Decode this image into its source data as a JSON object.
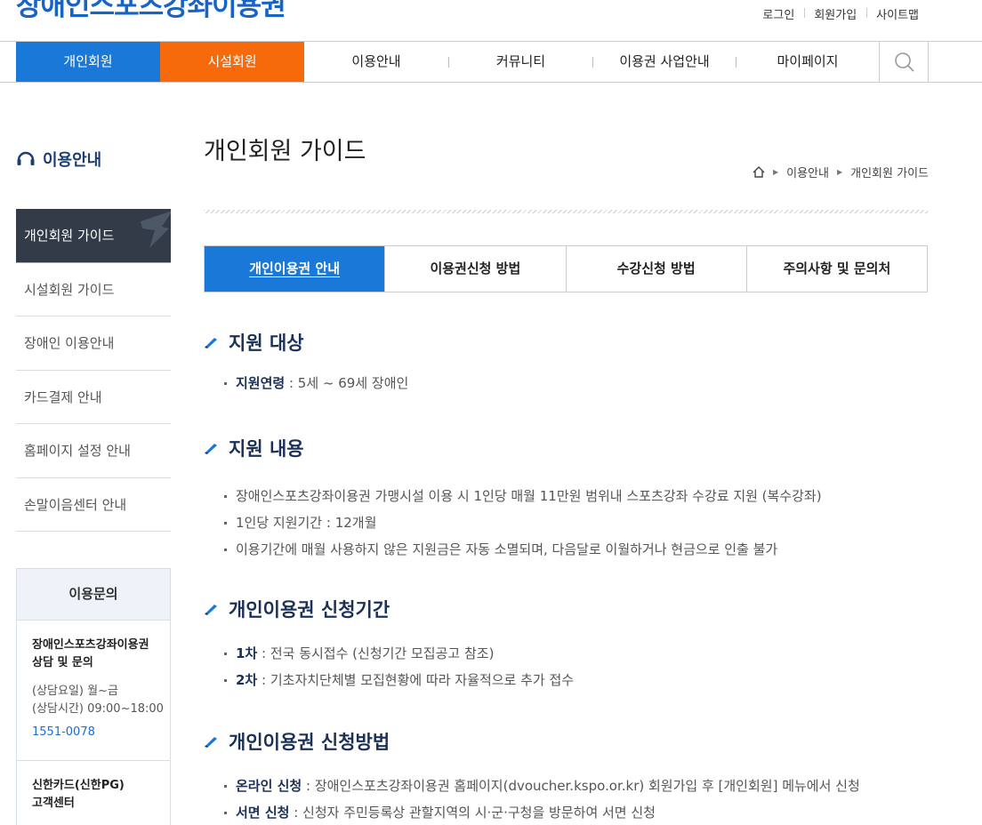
{
  "site": {
    "title": "장애인스포츠강좌이용권"
  },
  "util_links": [
    "로그인",
    "회원가입",
    "사이트맵"
  ],
  "gnb": {
    "items": [
      "개인회원",
      "시설회원",
      "이용안내",
      "커뮤니티",
      "이용권 사업안내",
      "마이페이지"
    ],
    "search_icon": "search-icon",
    "colors": {
      "active": "#1a78d9",
      "secondary": "#f76a0c"
    }
  },
  "lnb": {
    "title": "이용안내",
    "items": [
      "개인회원 가이드",
      "시설회원 가이드",
      "장애인 이용안내",
      "카드결제 안내",
      "홈페이지 설정 안내",
      "손말이음센터 안내"
    ]
  },
  "inquiry": {
    "title": "이용문의",
    "blocks": [
      {
        "name": "장애인스포츠강좌이용권 상담 및 문의",
        "days": "(상담요일) 월~금",
        "hours": "(상담시간) 09:00~18:00",
        "tel": "1551-0078"
      },
      {
        "name": "신한카드(신한PG) 고객센터"
      }
    ]
  },
  "page": {
    "title": "개인회원 가이드",
    "breadcrumb": [
      "이용안내",
      "개인회원 가이드"
    ],
    "tabs": [
      "개인이용권 안내",
      "이용권신청 방법",
      "수강신청 방법",
      "주의사항 및 문의처"
    ]
  },
  "sections": [
    {
      "title": "지원 대상",
      "items": [
        {
          "label": "지원연령",
          "text": " : 5세 ~ 69세 장애인"
        }
      ]
    },
    {
      "title": "지원 내용",
      "items": [
        {
          "text": "장애인스포츠강좌이용권 가맹시설 이용 시 1인당 매월 11만원 범위내 스포츠강좌 수강료 지원 (복수강좌)"
        },
        {
          "text": "1인당 지원기간 : 12개월"
        },
        {
          "text": "이용기간에 매월 사용하지 않은 지원금은 자동 소멸되며, 다음달로 이월하거나 현금으로 인출 불가"
        }
      ]
    },
    {
      "title": "개인이용권 신청기간",
      "items": [
        {
          "label": "1차",
          "text": " : 전국 동시접수 (신청기간 모집공고 참조)"
        },
        {
          "label": "2차",
          "text": " : 기초자치단체별 모집현황에 따라 자율적으로 추가 접수"
        }
      ]
    },
    {
      "title": "개인이용권 신청방법",
      "items": [
        {
          "label": "온라인 신청",
          "text": " : 장애인스포츠강좌이용권 홈페이지(dvoucher.kspo.or.kr) 회원가입 후 [개인회원] 메뉴에서 신청"
        },
        {
          "label": "서면 신청",
          "text": " : 신청자 주민등록상 관할지역의 시·군·구청을 방문하여 서면 신청"
        }
      ]
    }
  ]
}
